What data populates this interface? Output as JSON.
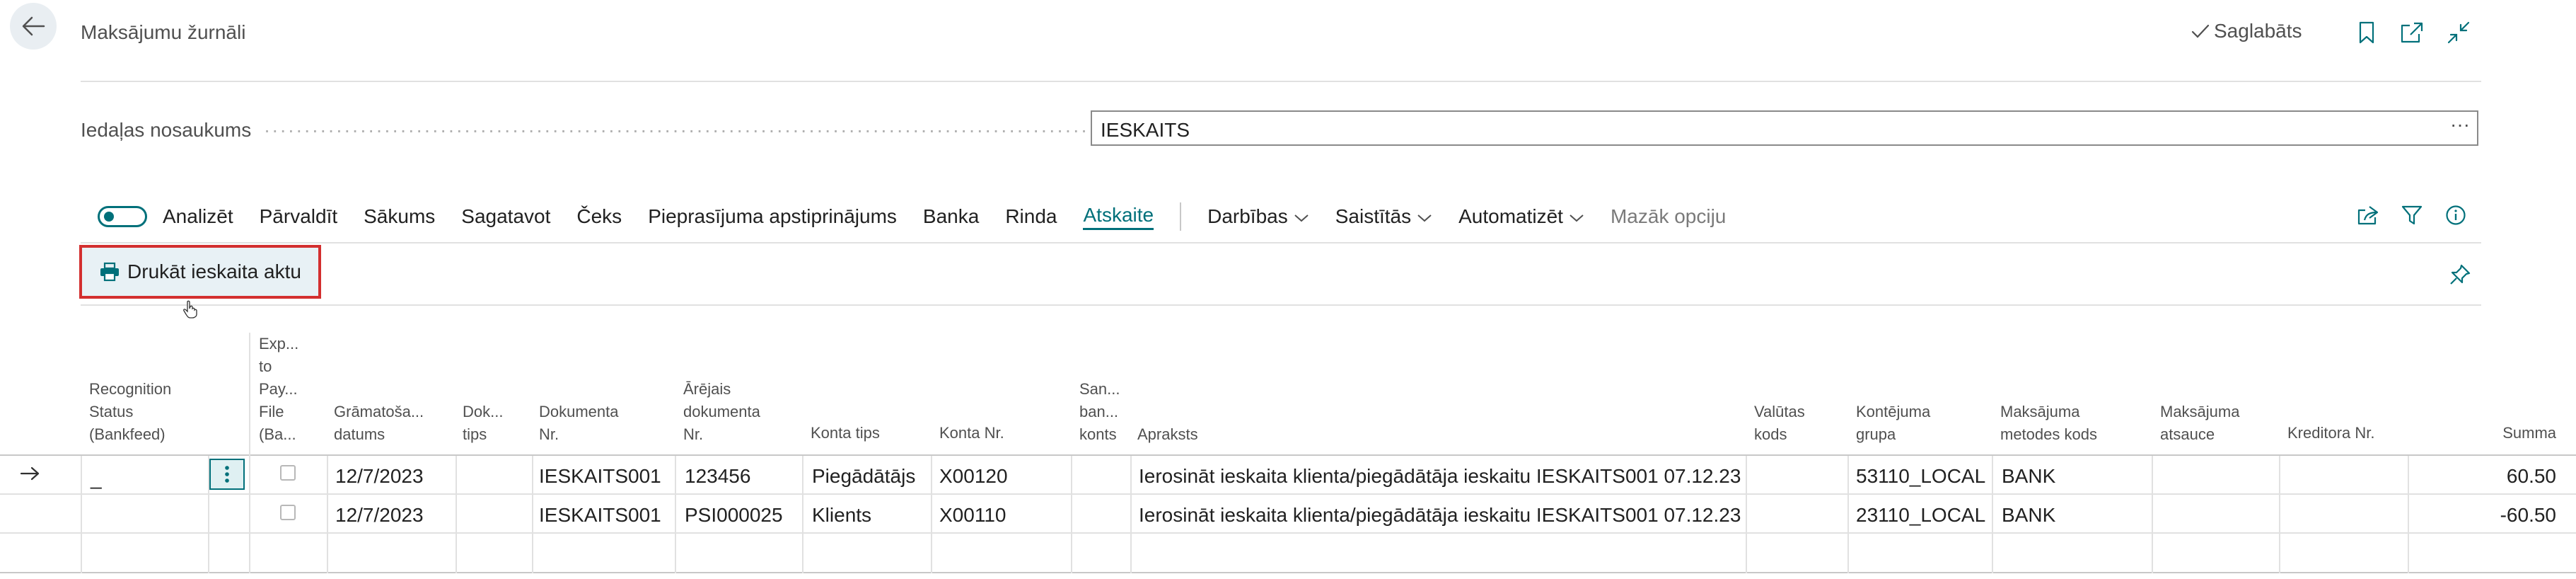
{
  "header": {
    "title": "Maksājumu žurnāli",
    "saved_status": "Saglabāts"
  },
  "field": {
    "label": "Iedaļas nosaukums",
    "value": "IESKAITS",
    "more": "···"
  },
  "actionbar": {
    "toggle_label": "Analizēt",
    "items": [
      "Pārvaldīt",
      "Sākums",
      "Sagatavot",
      "Čeks",
      "Pieprasījuma apstiprinājums",
      "Banka",
      "Rinda",
      "Atskaite"
    ],
    "active_tab": "Atskaite",
    "menus": [
      "Darbības",
      "Saistītās",
      "Automatizēt"
    ],
    "fewer_options": "Mazāk opciju"
  },
  "report_action": {
    "label": "Drukāt ieskaita aktu"
  },
  "grid": {
    "columns": {
      "recognition_status": [
        "Recognition",
        "Status",
        "(Bankfeed)"
      ],
      "export": [
        "Exp...",
        "to",
        "Pay...",
        "File",
        "(Ba..."
      ],
      "posting_date": [
        "Grāmatoša...",
        "datums"
      ],
      "doc_type": [
        "Dok...",
        "tips"
      ],
      "doc_no": [
        "Dokumenta",
        "Nr."
      ],
      "ext_doc_no": [
        "Ārējais",
        "dokumenta",
        "Nr."
      ],
      "account_type": [
        "Konta tips"
      ],
      "account_no": [
        "Konta Nr."
      ],
      "bal_account": [
        "San...",
        "ban...",
        "konts"
      ],
      "description": [
        "Apraksts"
      ],
      "currency": [
        "Valūtas",
        "kods"
      ],
      "posting_group": [
        "Kontējuma",
        "grupa"
      ],
      "payment_method": [
        "Maksājuma",
        "metodes kods"
      ],
      "payment_ref": [
        "Maksājuma",
        "atsauce"
      ],
      "creditor_no": [
        "Kreditora Nr."
      ],
      "amount": [
        "Summa"
      ]
    },
    "rows": [
      {
        "recognition_status": "_",
        "posting_date": "12/7/2023",
        "doc_no": "IESKAITS001",
        "ext_doc_no": "123456",
        "account_type": "Piegādātājs",
        "account_no": "X00120",
        "description": "Ierosināt ieskaita klienta/piegādātāja ieskaitu IESKAITS001 07.12.23",
        "posting_group": "53110_LOCAL",
        "payment_method": "BANK",
        "amount": "60.50"
      },
      {
        "recognition_status": "",
        "posting_date": "12/7/2023",
        "doc_no": "IESKAITS001",
        "ext_doc_no": "PSI000025",
        "account_type": "Klients",
        "account_no": "X00110",
        "description": "Ierosināt ieskaita klienta/piegādātāja ieskaitu IESKAITS001 07.12.23",
        "posting_group": "23110_LOCAL",
        "payment_method": "BANK",
        "amount": "-60.50"
      }
    ]
  },
  "colors": {
    "accent": "#00707a",
    "highlight_border": "#d32f2f"
  }
}
